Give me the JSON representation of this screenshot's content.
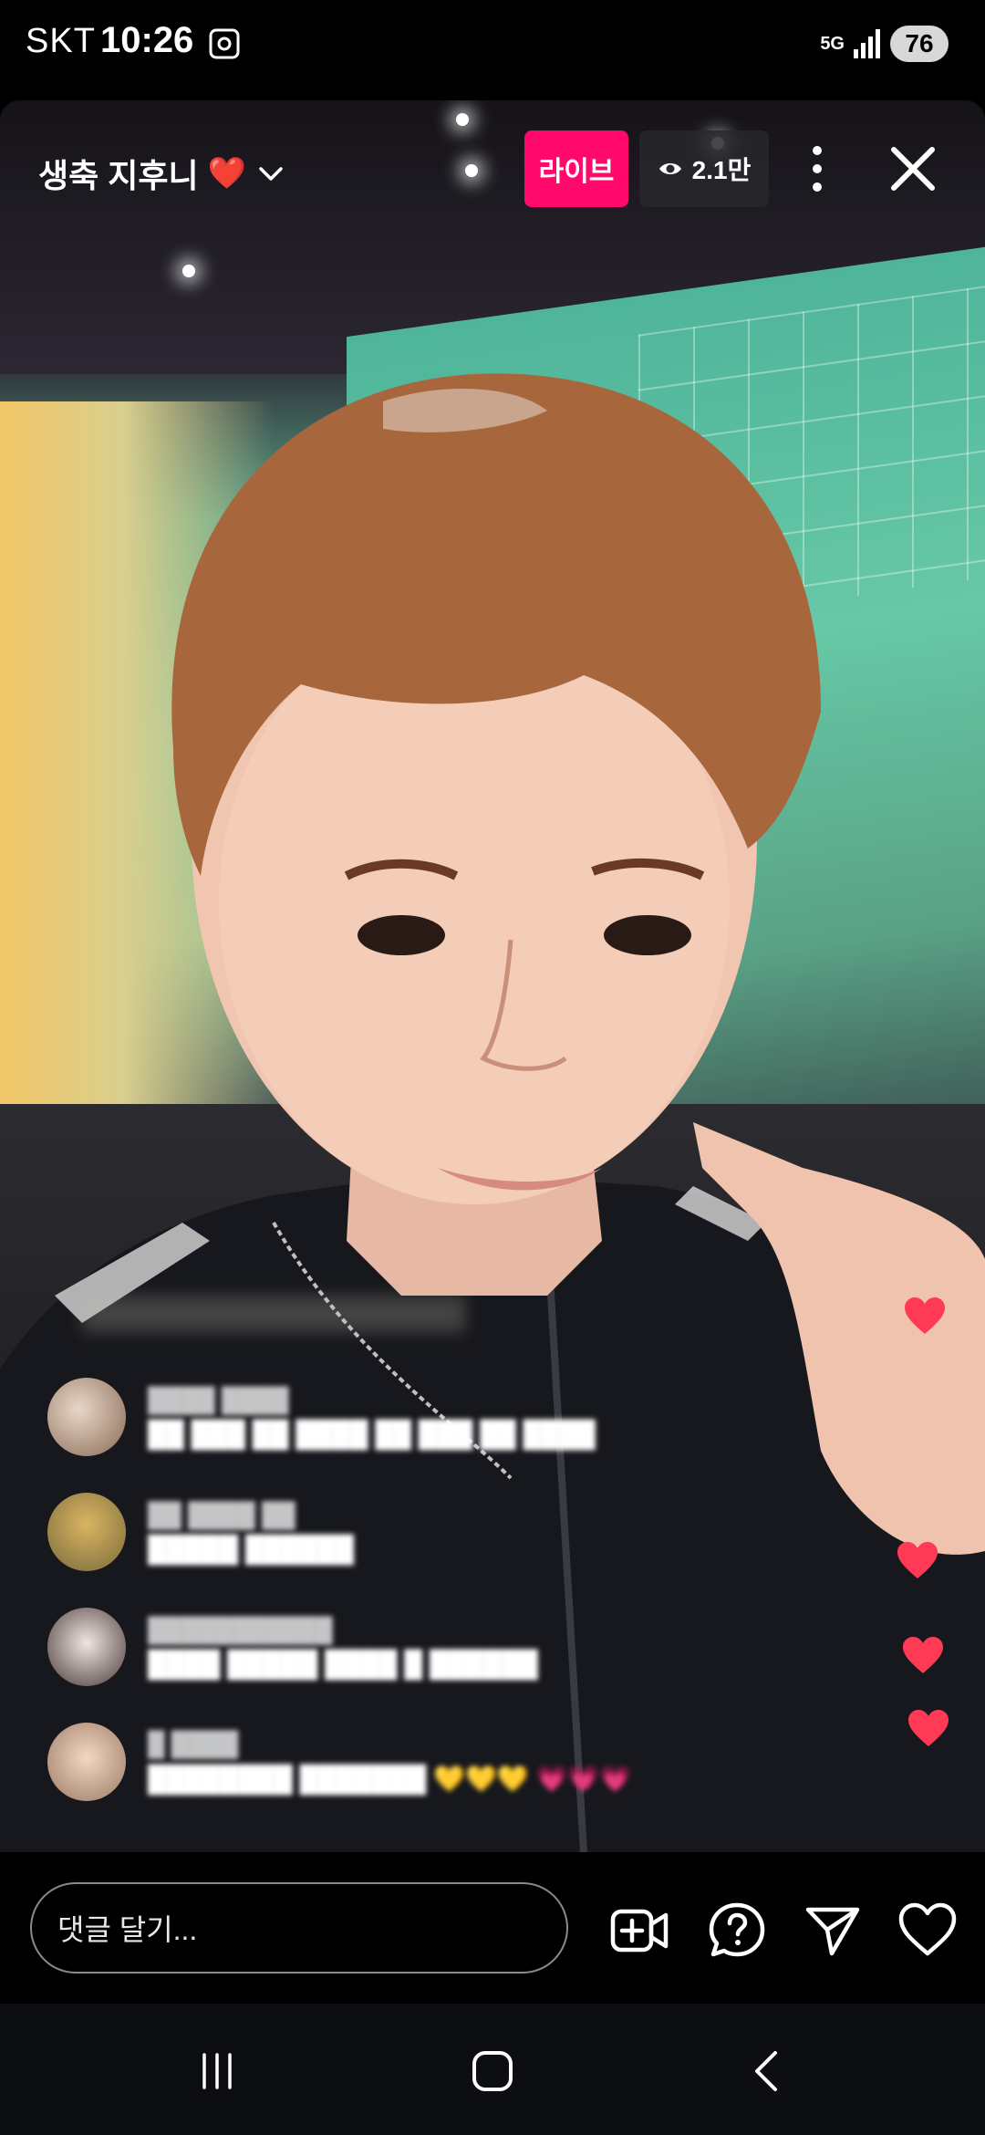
{
  "status_bar": {
    "carrier": "SKT",
    "time": "10:26",
    "network": "5G",
    "battery": "76"
  },
  "live": {
    "host_name": "생축 지후니",
    "host_emoji": "❤️",
    "live_badge": "라이브",
    "viewer_count": "2.1만"
  },
  "comments": [
    {
      "user": "████ ████",
      "text": "██ ███ ██ ████ ██ ███ ██ ████"
    },
    {
      "user": "██ ████ ██",
      "text": "█████ ██████"
    },
    {
      "user": "███████████",
      "text": "████ █████ ████ █ ██████"
    },
    {
      "user": "█ ████",
      "text": "████████ ███████ 💛💛💛 💗💗💗"
    }
  ],
  "input": {
    "placeholder": "댓글 달기..."
  },
  "colors": {
    "live_badge": "#ff0a6c",
    "heart": "#ff3a55",
    "background": "#000000"
  },
  "icons": [
    "screenshot-icon",
    "signal-icon",
    "chevron-down-icon",
    "eye-icon",
    "more-vertical-icon",
    "close-icon",
    "add-video-icon",
    "question-icon",
    "send-icon",
    "heart-outline-icon",
    "recent-apps-icon",
    "home-icon",
    "back-icon"
  ]
}
